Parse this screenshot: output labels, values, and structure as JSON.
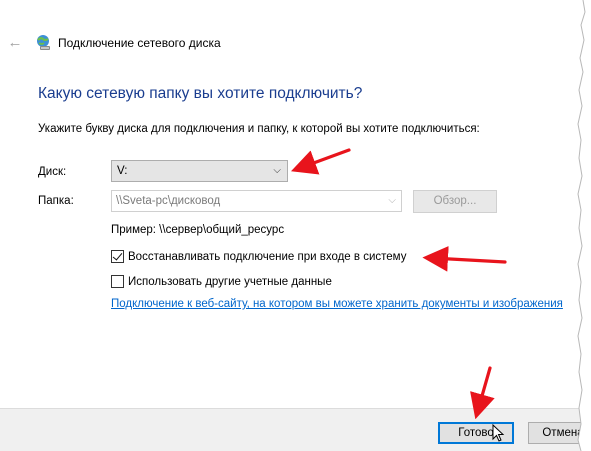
{
  "window": {
    "title": "Подключение сетевого диска",
    "back_glyph": "←"
  },
  "main": {
    "heading": "Какую сетевую папку вы хотите подключить?",
    "instruction": "Укажите букву диска для подключения и папку, к которой вы хотите подключиться:",
    "drive_label": "Диск:",
    "drive_value": "V:",
    "folder_label": "Папка:",
    "folder_value": "\\\\Sveta-pc\\дисковод",
    "browse_label": "Обзор...",
    "example": "Пример: \\\\сервер\\общий_ресурс",
    "reconnect_label": "Восстанавливать подключение при входе в систему",
    "reconnect_checked": true,
    "other_creds_label": "Использовать другие учетные данные",
    "other_creds_checked": false,
    "web_link": "Подключение к веб-сайту, на котором вы можете хранить документы и изображения"
  },
  "footer": {
    "finish_label": "Готово",
    "cancel_label": "Отмена"
  },
  "colors": {
    "heading": "#1a3d8f",
    "link": "#0066cc",
    "annotation_arrow": "#e8141c",
    "focus_border": "#0078d7"
  },
  "icons": {
    "title_icon": "network-drive-icon",
    "back": "back-arrow-icon",
    "chevron": "chevron-down-icon"
  }
}
